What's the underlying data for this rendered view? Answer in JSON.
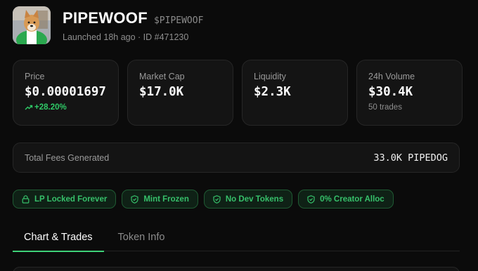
{
  "token": {
    "name": "PIPEWOOF",
    "ticker": "$PIPEWOOF",
    "meta": "Launched 18h ago · ID #471230",
    "avatar_icon": "shiba-dog-avatar"
  },
  "stats": [
    {
      "label": "Price",
      "value": "$0.00001697",
      "change": "+28.20%",
      "change_color": "#2fca67",
      "change_icon": "trend-up-icon"
    },
    {
      "label": "Market Cap",
      "value": "$17.0K"
    },
    {
      "label": "Liquidity",
      "value": "$2.3K"
    },
    {
      "label": "24h Volume",
      "value": "$30.4K",
      "sub": "50 trades"
    }
  ],
  "fees": {
    "label": "Total Fees Generated",
    "value": "33.0K PIPEDOG"
  },
  "badges": [
    {
      "label": "LP Locked Forever",
      "icon": "lock-icon"
    },
    {
      "label": "Mint Frozen",
      "icon": "shield-check-icon"
    },
    {
      "label": "No Dev Tokens",
      "icon": "shield-check-icon"
    },
    {
      "label": "0% Creator Alloc",
      "icon": "shield-check-icon"
    }
  ],
  "tabs": [
    {
      "label": "Chart & Trades",
      "active": true
    },
    {
      "label": "Token Info",
      "active": false
    }
  ],
  "colors": {
    "accent_green": "#3ed178",
    "badge_green": "#36c06a",
    "background": "#0b0b0b",
    "card": "#141414"
  }
}
